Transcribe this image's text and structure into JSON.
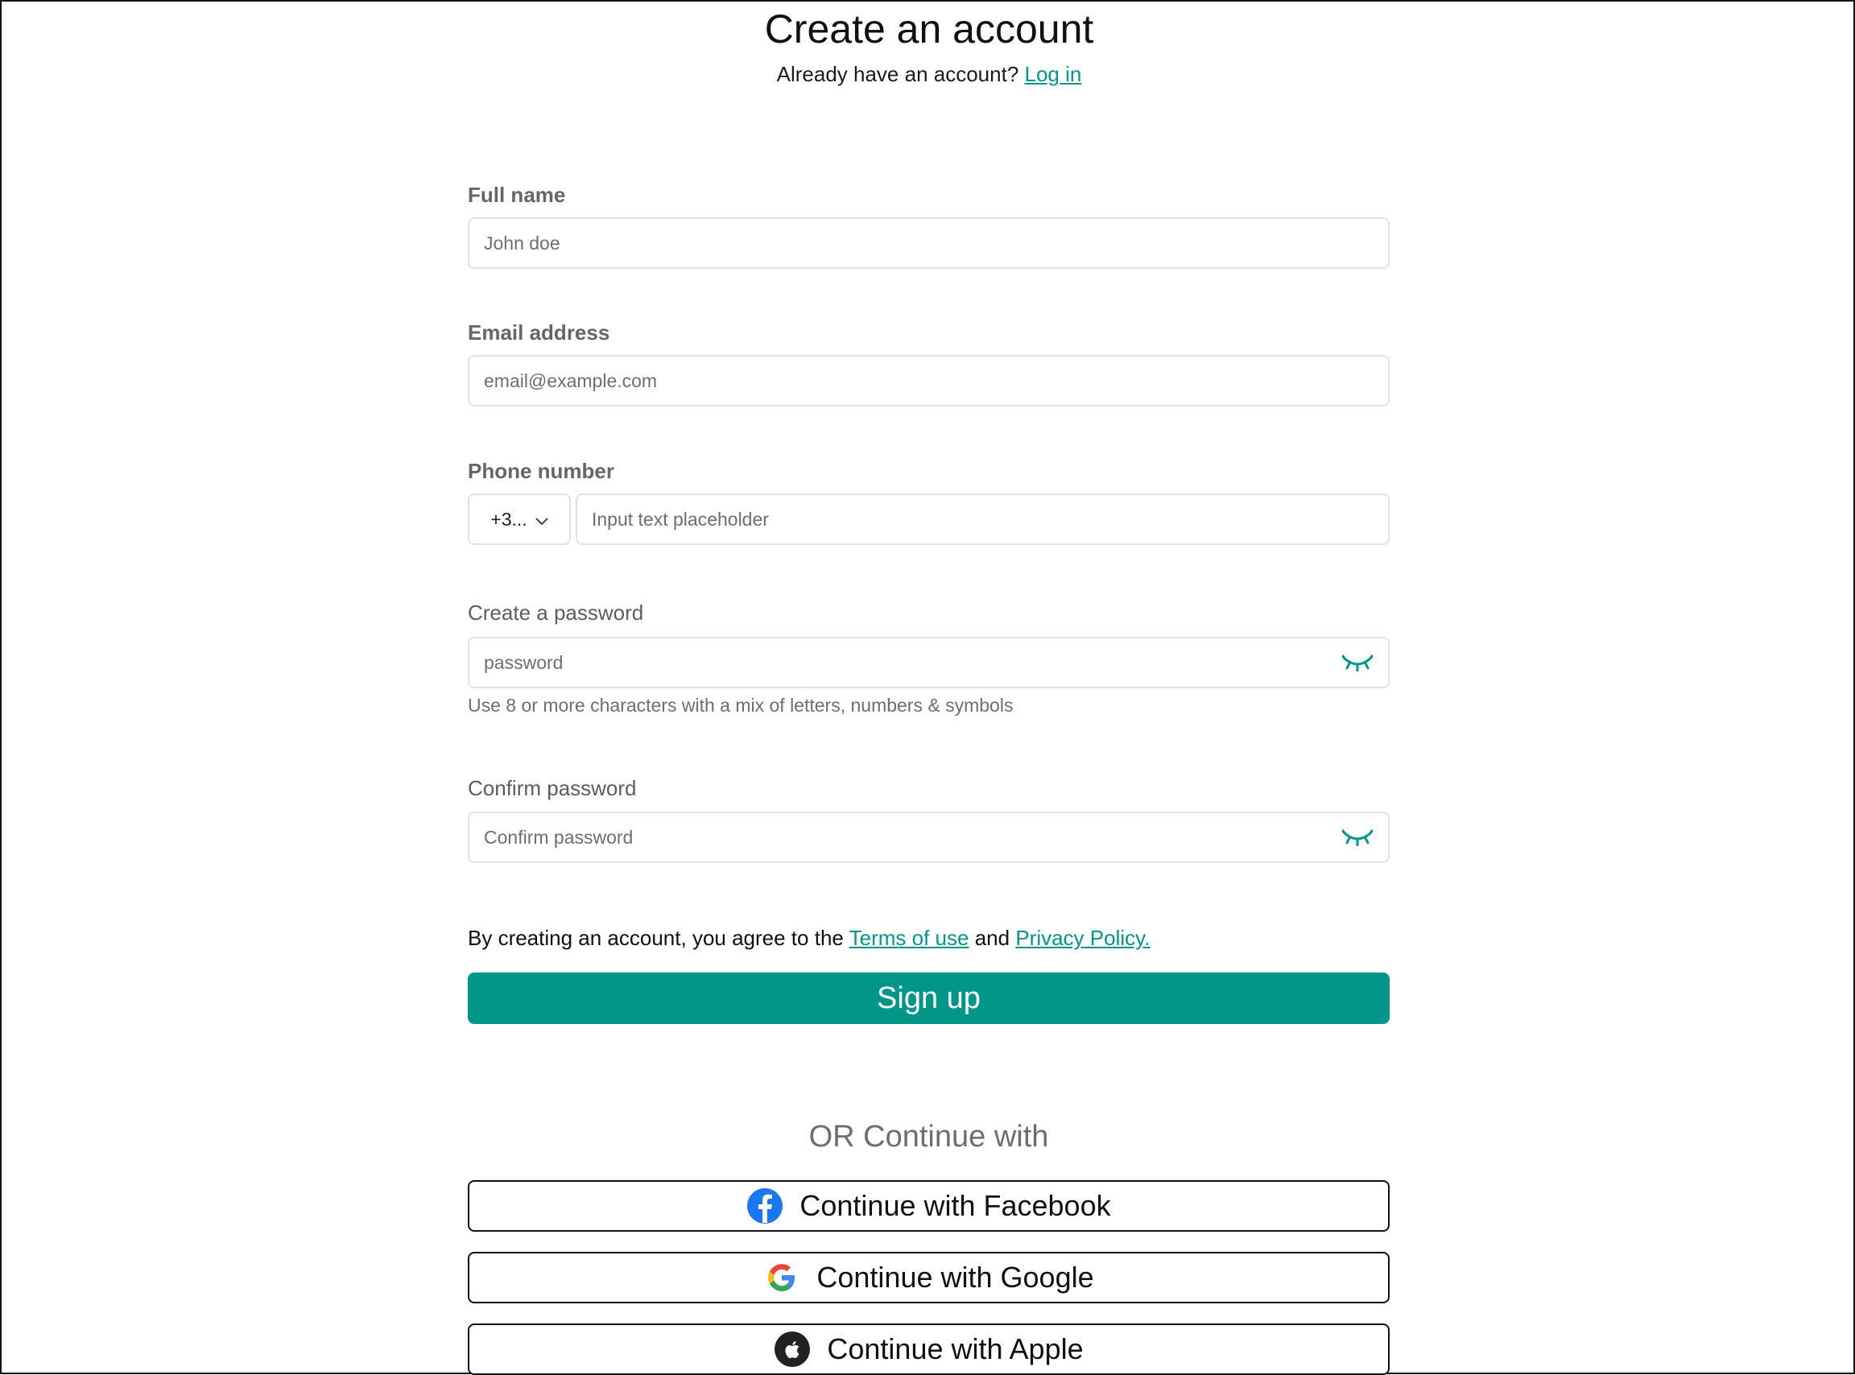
{
  "header": {
    "title": "Create an account",
    "subtitle_prefix": "Already have an account?",
    "login_link": "Log in"
  },
  "form": {
    "full_name": {
      "label": "Full name",
      "placeholder": "John doe"
    },
    "email": {
      "label": "Email address",
      "placeholder": "email@example.com"
    },
    "phone": {
      "label": "Phone number",
      "country_code": "+3...",
      "placeholder": "Input text placeholder"
    },
    "password": {
      "label": "Create a password",
      "placeholder": "password",
      "hint": "Use 8 or more characters with a mix of letters, numbers & symbols"
    },
    "confirm_password": {
      "label": "Confirm password",
      "placeholder": "Confirm password"
    },
    "terms": {
      "prefix": "By creating an account, you agree to the",
      "terms_link": "Terms of use",
      "and": "and",
      "privacy_link": "Privacy Policy."
    },
    "signup_label": "Sign up"
  },
  "social": {
    "divider": "OR Continue with",
    "facebook": "Continue with Facebook",
    "google": "Continue with Google",
    "apple": "Continue with Apple"
  },
  "colors": {
    "accent": "#009688",
    "facebook": "#1877F2"
  }
}
